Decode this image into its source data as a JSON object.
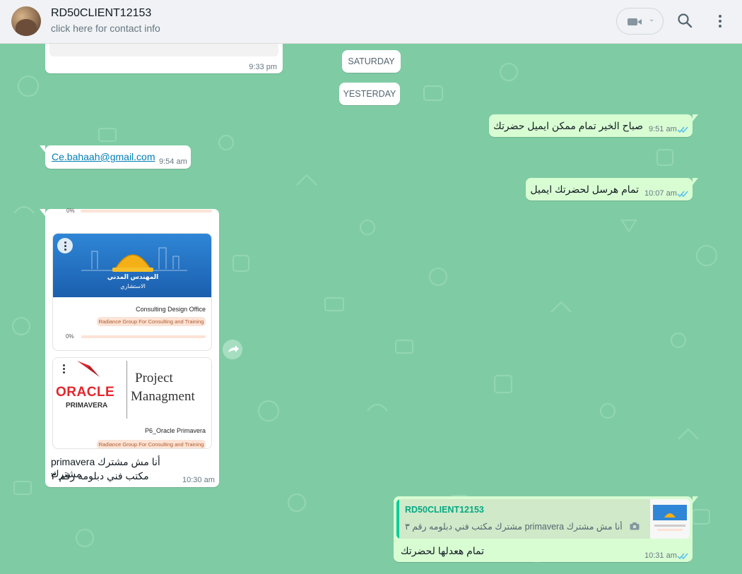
{
  "header": {
    "contact_name": "RD50CLIENT12153",
    "contact_subtitle": "click here for contact info",
    "chevron": "⌄"
  },
  "icons": {
    "avatar": "profile-photo",
    "video": "video-camera-icon",
    "search": "search-icon",
    "menu": "kebab-menu-icon",
    "ticks": "double-check-icon",
    "forward": "forward-arrow-icon",
    "camera": "camera-icon"
  },
  "colors": {
    "chat_bg": "#7fcca4",
    "outgoing": "#d9fdd3",
    "incoming": "#ffffff",
    "tick_blue": "#53bdeb",
    "reply_bar": "#06cf9c"
  },
  "dates": {
    "saturday": "SATURDAY",
    "yesterday": "YESTERDAY"
  },
  "messages": {
    "top_partial": {
      "time": "9:33 pm"
    },
    "m1": {
      "text": "صباح الخير تمام ممكن ايميل حضرتك",
      "time": "9:51 am"
    },
    "m2": {
      "text": "Ce.bahaah@gmail.com",
      "time": "9:54 am"
    },
    "m3": {
      "text": "تمام هرسل لحضرتك ايميل",
      "time": "10:07 am"
    },
    "m4": {
      "card0_pct": "0%",
      "card1": {
        "image_line1": "المهندس المدني",
        "image_line2": "الاستشاري",
        "title": "Consulting Design Office",
        "badge": "Radiance Group For Consulting and Training",
        "pct": "0%"
      },
      "card2": {
        "logo_text": "ORACLE",
        "logo_sub": "PRIMAVERA",
        "heading_line1": "Project",
        "heading_line2": "Managment",
        "title": "P6_Oracle Primavera",
        "badge": "Radiance Group For Consulting and Training"
      },
      "caption_line1": "أنا مش مشترك primavera مشترك",
      "caption_line2": "مكتب فني دبلومه رقم ٣",
      "time": "10:30 am"
    },
    "m5": {
      "quoted_author": "RD50CLIENT12153",
      "quoted_text": "أنا مش مشترك primavera مشترك مكتب فني دبلومه رقم ٣",
      "text": "تمام هعدلها لحضرتك",
      "time": "10:31 am"
    }
  }
}
